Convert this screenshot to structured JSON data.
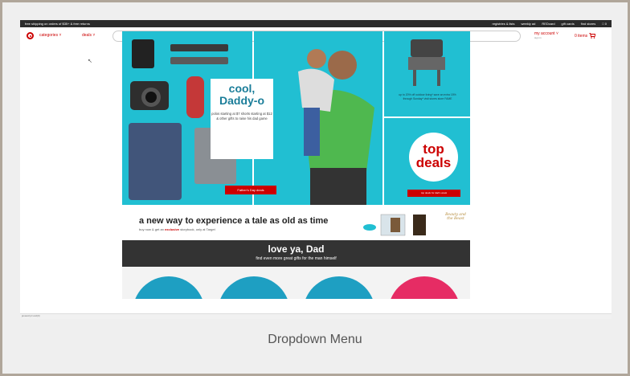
{
  "topbar": {
    "left": "free shipping on orders of $35+ & free returns",
    "links": [
      "registries & lists",
      "weekly ad",
      "REDcard",
      "gift cards",
      "find stores",
      "□ 0"
    ]
  },
  "header": {
    "categories": "categories ˅",
    "deals": "deals ˅",
    "search_placeholder": "Q search",
    "account": "my account ˅",
    "account_sub": "sign in",
    "cart": "0 items"
  },
  "promo": {
    "headline": "cool, Daddy-o",
    "text": "polos starting at $7 shorts starting at $12 & other gifts to raise his dad game",
    "button": "Father's Day deals"
  },
  "outdoor": {
    "text": "up to 20% off outdoor living* save an extra 15% through Sunday* visit stores store FAME"
  },
  "top_deals": {
    "title": "top deals",
    "button": "top deals for dad's week"
  },
  "banner": {
    "headline": "a new way to experience a tale as old as time",
    "sub_pre": "buy now & get an",
    "sub_em": "exclusive",
    "sub_post": "storybook, only at Target",
    "logo": "Beauty and the Beast"
  },
  "dad_band": {
    "title": "love ya, Dad",
    "subtitle": "find even more great gifts for the man himself"
  },
  "status": "javascript:void(0)",
  "caption": "Dropdown Menu",
  "colors": {
    "brand": "#cc0000",
    "promo": "#21bfd2",
    "frame": "#b0a69a"
  }
}
